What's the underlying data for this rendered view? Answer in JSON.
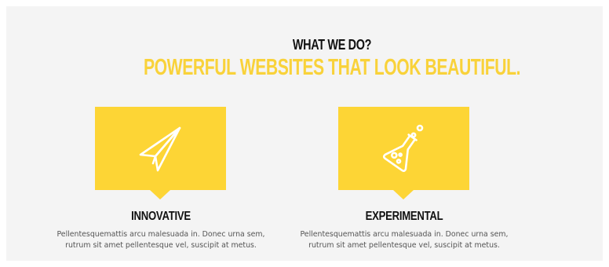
{
  "section": {
    "kicker": "WHAT WE DO?",
    "headline": "POWERFUL WEBSITES THAT LOOK BEAUTIFUL."
  },
  "features": [
    {
      "icon": "paper-plane-icon",
      "title": "INNOVATIVE",
      "text": "Pellentesquemattis arcu malesuada in. Donec urna sem, rutrum sit amet pellentesque vel, suscipit at metus."
    },
    {
      "icon": "flask-icon",
      "title": "EXPERIMENTAL",
      "text": "Pellentesquemattis arcu malesuada in. Donec urna sem, rutrum sit amet pellentesque vel, suscipit at metus."
    }
  ],
  "colors": {
    "accent": "#fdd535",
    "headline": "#f9d23a",
    "background": "#f4f4f4",
    "title": "#111111",
    "body_text": "#555555"
  }
}
